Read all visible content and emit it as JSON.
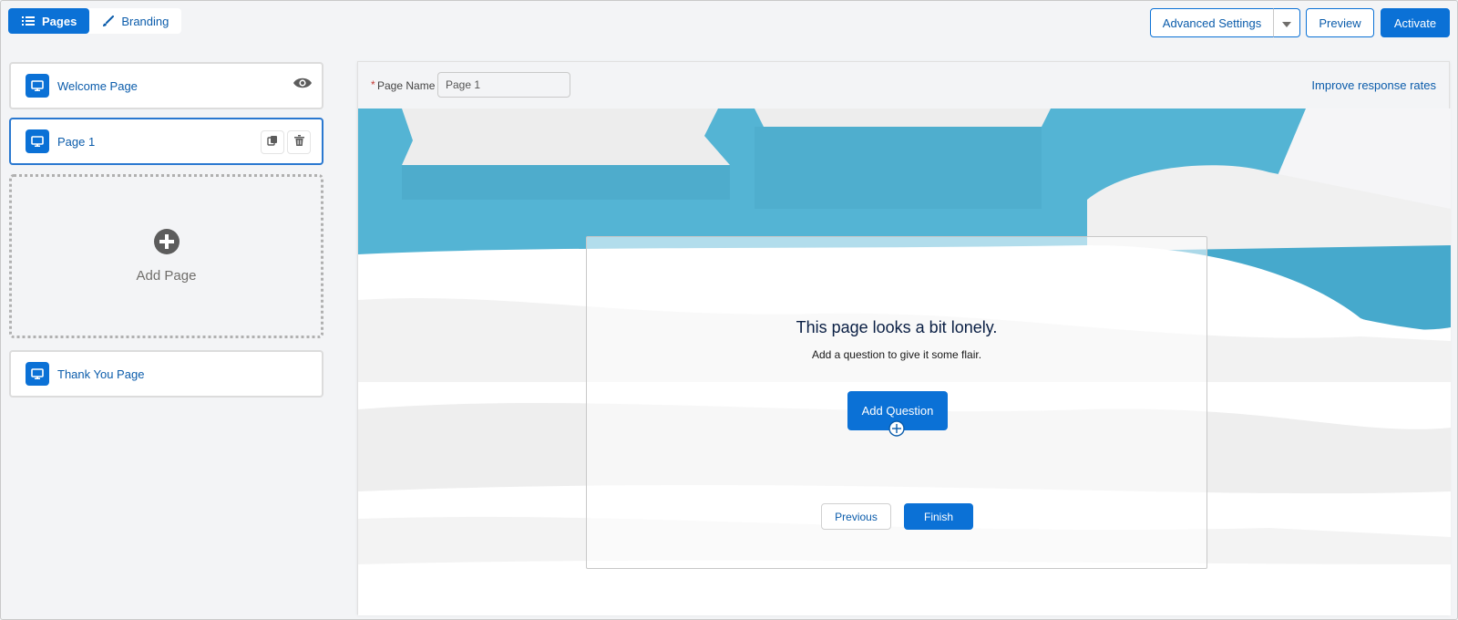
{
  "tabs": [
    {
      "label": "Pages",
      "icon": "list-icon",
      "active": true
    },
    {
      "label": "Branding",
      "icon": "brush-icon",
      "active": false
    }
  ],
  "toolbar": {
    "advanced_settings_label": "Advanced Settings",
    "preview_label": "Preview",
    "activate_label": "Activate"
  },
  "pages": [
    {
      "label": "Welcome Page",
      "icon": "monitor-icon"
    },
    {
      "label": "Page 1",
      "icon": "monitor-icon",
      "selected": true
    },
    {
      "label": "Thank You Page",
      "icon": "monitor-icon"
    }
  ],
  "add_page": {
    "label": "Add Page",
    "icon": "plus-circle-icon"
  },
  "editor": {
    "page_name_label": "Page Name",
    "page_name_value": "Page 1",
    "improve_link": "Improve response rates",
    "empty_title": "This page looks a bit lonely.",
    "empty_subtitle": "Add a question to give it some flair.",
    "add_question_label": "Add Question",
    "previous_label": "Previous",
    "finish_label": "Finish"
  },
  "colors": {
    "brand": "#0b71d6",
    "link": "#0b5cab",
    "required": "#c23934",
    "sky": "#54b4d4"
  }
}
